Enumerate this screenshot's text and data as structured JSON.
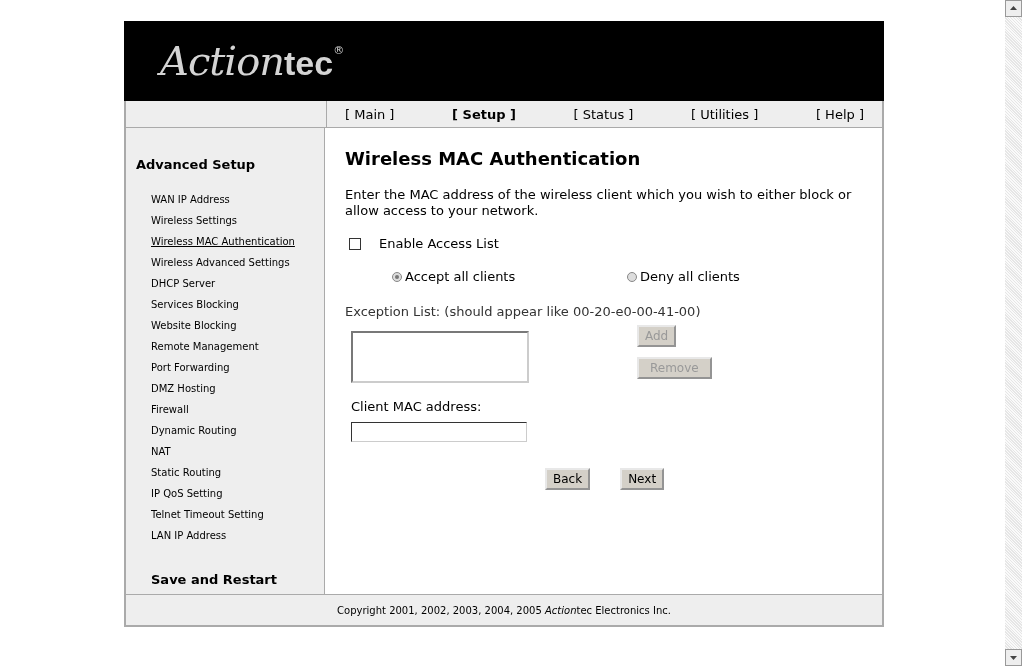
{
  "logo": {
    "script": "Action",
    "bold": "tec",
    "mark": "®"
  },
  "nav": [
    {
      "label": "[ Main ]",
      "selected": false
    },
    {
      "label": "[ Setup ]",
      "selected": true
    },
    {
      "label": "[ Status ]",
      "selected": false
    },
    {
      "label": "[ Utilities ]",
      "selected": false
    },
    {
      "label": "[ Help ]",
      "selected": false
    }
  ],
  "sidebar": {
    "heading": "Advanced Setup",
    "items": [
      {
        "label": "WAN IP Address",
        "selected": false
      },
      {
        "label": "Wireless Settings",
        "selected": false
      },
      {
        "label": "Wireless MAC Authentication",
        "selected": true
      },
      {
        "label": "Wireless Advanced Settings",
        "selected": false
      },
      {
        "label": "DHCP Server",
        "selected": false
      },
      {
        "label": "Services Blocking",
        "selected": false
      },
      {
        "label": "Website Blocking",
        "selected": false
      },
      {
        "label": "Remote Management",
        "selected": false
      },
      {
        "label": "Port Forwarding",
        "selected": false
      },
      {
        "label": "DMZ Hosting",
        "selected": false
      },
      {
        "label": "Firewall",
        "selected": false
      },
      {
        "label": "Dynamic Routing",
        "selected": false
      },
      {
        "label": "NAT",
        "selected": false
      },
      {
        "label": "Static Routing",
        "selected": false
      },
      {
        "label": "IP QoS Setting",
        "selected": false
      },
      {
        "label": "Telnet Timeout Setting",
        "selected": false
      },
      {
        "label": "LAN IP Address",
        "selected": false
      }
    ],
    "footer_link": "Save and Restart"
  },
  "content": {
    "title": "Wireless MAC Authentication",
    "description": "Enter the MAC address of the wireless client which you wish to either block or allow access to your network.",
    "enable_access_list": {
      "label": "Enable Access List",
      "checked": false
    },
    "radios": [
      {
        "label": "Accept all clients",
        "selected": true,
        "disabled": true
      },
      {
        "label": "Deny all clients",
        "selected": false,
        "disabled": true
      }
    ],
    "exception_label": "Exception List: (should appear like 00-20-e0-00-41-00)",
    "list_buttons": [
      {
        "label": "Add",
        "disabled": true
      },
      {
        "label": "Remove",
        "disabled": true
      }
    ],
    "client_mac_label": "Client MAC address:",
    "buttons": [
      {
        "label": "Back"
      },
      {
        "label": "Next"
      }
    ]
  },
  "footer": {
    "before": "Copyright 2001, 2002, 2003, 2004, 2005 ",
    "brand_italic": "Action",
    "after": "tec Electronics Inc."
  }
}
